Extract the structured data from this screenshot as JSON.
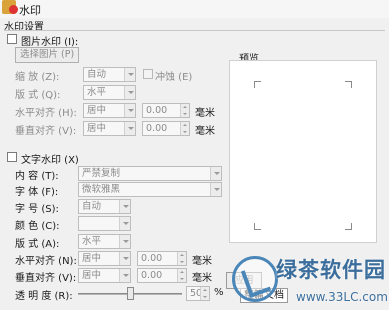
{
  "window": {
    "title": "水印"
  },
  "section": {
    "title": "水印设置"
  },
  "picture_watermark": {
    "checkbox_label": "图片水印 (I):",
    "select_button": "选择图片 (P)",
    "scale_label": "缩  放 (Z):",
    "scale_value": "自动",
    "washout_label": "冲蚀 (E)",
    "layout_label": "版  式 (Q):",
    "layout_value": "水平",
    "halign_label": "水平对齐 (H):",
    "halign_value": "居中",
    "halign_offset": "0.00",
    "valign_label": "垂直对齐 (V):",
    "valign_value": "居中",
    "valign_offset": "0.00",
    "unit": "毫米"
  },
  "text_watermark": {
    "checkbox_label": "文字水印 (X)",
    "content_label": "内  容 (T):",
    "content_value": "严禁复制",
    "font_label": "字  体 (F):",
    "font_value": "微软雅黑",
    "size_label": "字  号 (S):",
    "size_value": "自动",
    "color_label": "颜  色 (C):",
    "color_value": "",
    "layout_label": "版  式 (A):",
    "layout_value": "水平",
    "halign_label": "水平对齐 (N):",
    "halign_value": "居中",
    "halign_offset": "0.00",
    "valign_label": "垂直对齐 (V):",
    "valign_value": "居中",
    "valign_offset": "0.00",
    "unit": "毫米",
    "transparency_label": "透 明 度 (R):",
    "transparency_value": "50",
    "transparency_unit": "%"
  },
  "preview": {
    "label": "预览"
  },
  "footer": {
    "apply_label": "应用",
    "apply_scope": "整篇文档"
  },
  "overlay_watermark": {
    "brand": "绿茶软件园",
    "url": "www.33LC.com"
  },
  "colors": {
    "background": "#f0f0f0",
    "watermark_blue": "#3b6e9c",
    "disabled_text": "#8c8c8c"
  }
}
